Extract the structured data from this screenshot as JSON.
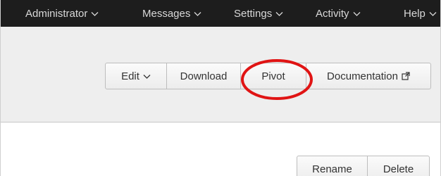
{
  "nav": {
    "administrator": "Administrator",
    "messages": "Messages",
    "settings": "Settings",
    "activity": "Activity",
    "help": "Help"
  },
  "toolbar": {
    "edit_label": "Edit",
    "download_label": "Download",
    "pivot_label": "Pivot",
    "documentation_label": "Documentation"
  },
  "actions": {
    "rename_label": "Rename",
    "delete_label": "Delete"
  },
  "colors": {
    "topbar": "#1d1d1d",
    "header_band": "#eeeeee",
    "highlight": "#e01414"
  },
  "icons": {
    "dropdown": "chevron-down-icon",
    "external": "external-link-icon"
  }
}
